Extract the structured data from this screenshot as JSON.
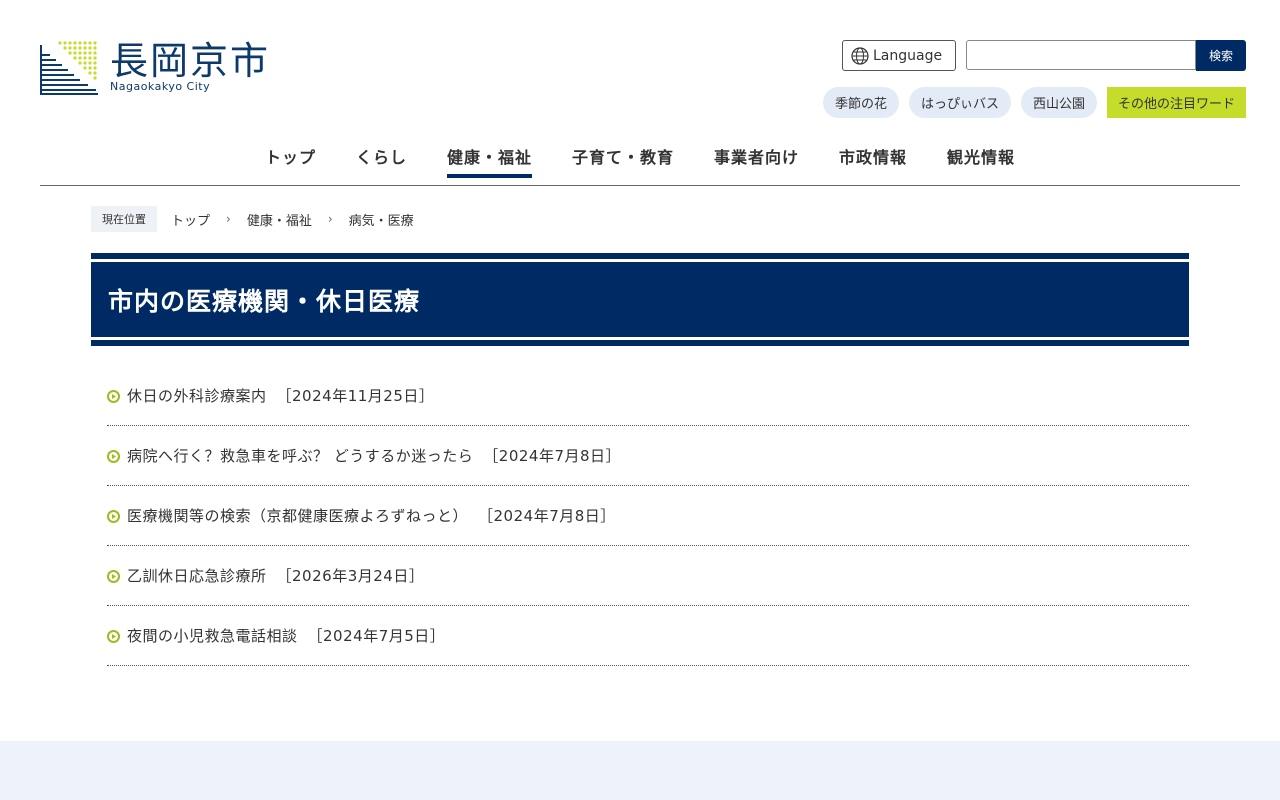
{
  "site": {
    "logo_title": "長岡京市",
    "logo_sub": "Nagaokakyo City"
  },
  "header": {
    "language_label": "Language",
    "search_placeholder": "",
    "search_button": "検索",
    "tags": [
      "季節の花",
      "はっぴぃバス",
      "西山公園"
    ],
    "more_tag": "その他の注目ワード"
  },
  "gnav": {
    "items": [
      "トップ",
      "くらし",
      "健康・福祉",
      "子育て・教育",
      "事業者向け",
      "市政情報",
      "観光情報"
    ],
    "active_index": 2
  },
  "breadcrumb": {
    "label": "現在位置",
    "items": [
      "トップ",
      "健康・福祉",
      "病気・医療"
    ]
  },
  "page": {
    "title": "市内の医療機関・休日医療"
  },
  "articles": [
    {
      "title": "休日の外科診療案内",
      "date": "［2024年11月25日］"
    },
    {
      "title": "病院へ行く？救急車を呼ぶ？ どうするか迷ったら",
      "date": "［2024年7月8日］"
    },
    {
      "title": "医療機関等の検索（京都健康医療よろずねっと）",
      "date": "［2024年7月8日］"
    },
    {
      "title": "乙訓休日応急診療所",
      "date": "［2026年3月24日］"
    },
    {
      "title": "夜間の小児救急電話相談",
      "date": "［2024年7月5日］"
    }
  ],
  "colors": {
    "brand_navy": "#002a64",
    "accent_green": "#c5dc2b",
    "tag_bg": "#e3ebf7"
  }
}
